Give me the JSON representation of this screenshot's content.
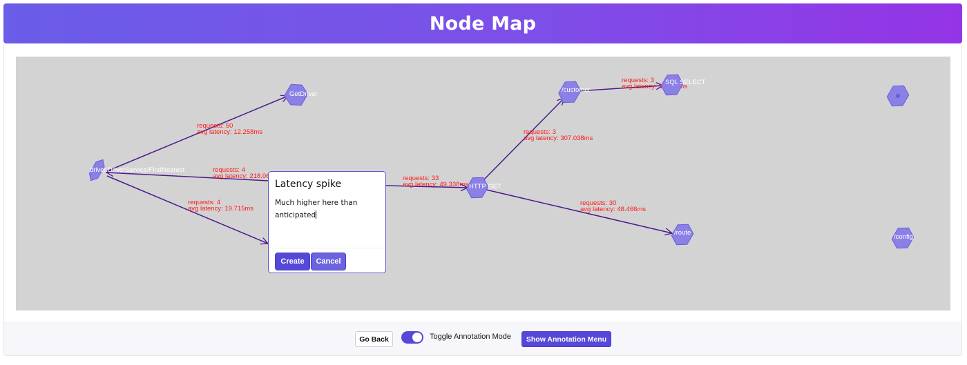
{
  "header": {
    "title": "Node Map"
  },
  "graph": {
    "nodes": [
      {
        "id": "n-driver",
        "label": "driver.DriverService/FindNearest"
      },
      {
        "id": "n-getdriver",
        "label": "GetDriver"
      },
      {
        "id": "n-httpget",
        "label": "HTTP GET"
      },
      {
        "id": "n-customer",
        "label": "/customer"
      },
      {
        "id": "n-sqlselect",
        "label": "SQL SELECT"
      },
      {
        "id": "n-route",
        "label": "/route"
      },
      {
        "id": "n-unlabeled",
        "label": ""
      },
      {
        "id": "n-config",
        "label": "/config"
      }
    ],
    "edges": [
      {
        "from": "driver.DriverService/FindNearest",
        "to": "GetDriver",
        "requests": "requests: 50",
        "latency": "avg latency: 12.258ms"
      },
      {
        "from": "HTTP GET",
        "to": "driver.DriverService/FindNearest",
        "requests": "requests: 4",
        "latency": "avg latency: 218.06ms"
      },
      {
        "from": "driver.DriverService/FindNearest",
        "to": "HTTP GET",
        "requests": "requests: 4",
        "latency": "avg latency: 19.715ms"
      },
      {
        "from": "driver.DriverService/FindNearest",
        "to": "HTTP GET",
        "requests": "requests: 33",
        "latency": "avg latency: 49.338ms"
      },
      {
        "from": "HTTP GET",
        "to": "/customer",
        "requests": "requests: 3",
        "latency": "avg latency: 307.038ms"
      },
      {
        "from": "/customer",
        "to": "SQL SELECT",
        "requests": "requests: 3",
        "latency": "avg latency: 300.17ms"
      },
      {
        "from": "HTTP GET",
        "to": "/route",
        "requests": "requests: 30",
        "latency": "avg latency: 48.466ms"
      }
    ]
  },
  "annotation_popup": {
    "title": "Latency spike",
    "body": "Much higher here than anticipated",
    "create_label": "Create",
    "cancel_label": "Cancel"
  },
  "footer": {
    "go_back_label": "Go Back",
    "toggle_label": "Toggle Annotation Mode",
    "toggle_on": true,
    "show_menu_label": "Show Annotation Menu"
  },
  "colors": {
    "header_gradient_start": "#6a5de8",
    "header_gradient_end": "#9434e6",
    "canvas_bg": "#d3d3d3",
    "node_fill": "#8a80e6",
    "edge": "#4b1a8c",
    "edge_label": "#ff1a1a",
    "accent": "#5548d9"
  }
}
